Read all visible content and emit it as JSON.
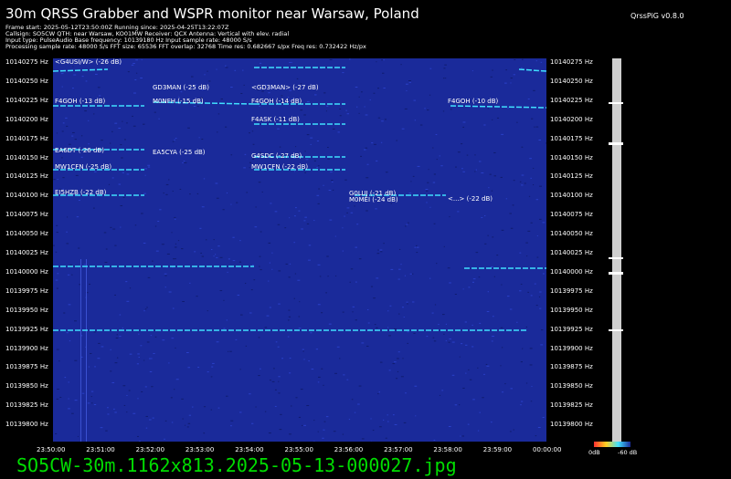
{
  "title": "30m QRSS Grabber and WSPR monitor near Warsaw, Poland",
  "version": "QrssPiG v0.8.0",
  "info_lines": [
    "Frame start: 2025-05-12T23:50:00Z Running since: 2025-04-25T13:22:07Z",
    "Callsign: SO5CW QTH: near Warsaw, KO01MW Receiver: QCX Antenna: Vertical with elev. radial",
    "Input type: PulseAudio Base frequency: 10139180 Hz Input sample rate: 48000 S/s",
    "Processing sample rate: 48000 S/s FFT size: 65536 FFT overlap: 32768 Time res: 0.682667 s/px Freq res: 0.732422 Hz/px"
  ],
  "freq_labels": [
    "10140275 Hz",
    "10140250 Hz",
    "10140225 Hz",
    "10140200 Hz",
    "10140175 Hz",
    "10140150 Hz",
    "10140125 Hz",
    "10140100 Hz",
    "10140075 Hz",
    "10140050 Hz",
    "10140025 Hz",
    "10140000 Hz",
    "10139975 Hz",
    "10139950 Hz",
    "10139925 Hz",
    "10139900 Hz",
    "10139875 Hz",
    "10139850 Hz",
    "10139825 Hz",
    "10139800 Hz"
  ],
  "time_labels": [
    "23:50:00",
    "23:51:00",
    "23:52:00",
    "23:53:00",
    "23:54:00",
    "23:55:00",
    "23:56:00",
    "23:57:00",
    "23:58:00",
    "23:59:00",
    "00:00:00"
  ],
  "spots": [
    {
      "text": "<G4USI/W> (-26 dB)"
    },
    {
      "text": "GD3MAN (-25 dB)"
    },
    {
      "text": "<GD3MAN> (-27 dB)"
    },
    {
      "text": "F4GOH (-13 dB)"
    },
    {
      "text": "M0NFH (-15 dB)"
    },
    {
      "text": "F4GOH (-14 dB)"
    },
    {
      "text": "F4GOH (-10 dB)"
    },
    {
      "text": "F4ASK (-11 dB)"
    },
    {
      "text": "EA6DT (-26 dB)"
    },
    {
      "text": "EA5CYA (-25 dB)"
    },
    {
      "text": "G4SDC (-27 dB)"
    },
    {
      "text": "MW1CFN (-25 dB)"
    },
    {
      "text": "MW1CFN (-22 dB)"
    },
    {
      "text": "EI5HZB (-22 dB)"
    },
    {
      "text": "G0LUJ (-21 dB)"
    },
    {
      "text": "M0MEI (-24 dB)"
    },
    {
      "text": "<...> (-22 dB)"
    }
  ],
  "db_scale": {
    "left": "0dB",
    "right": "-60 dB"
  },
  "filename": "SO5CW-30m.1162x813.2025-05-13-000027.jpg",
  "colors": {
    "background": "#000000",
    "waterfall": "#1a2a9a",
    "signal": "#40e0ff",
    "filename": "#00dd00"
  }
}
